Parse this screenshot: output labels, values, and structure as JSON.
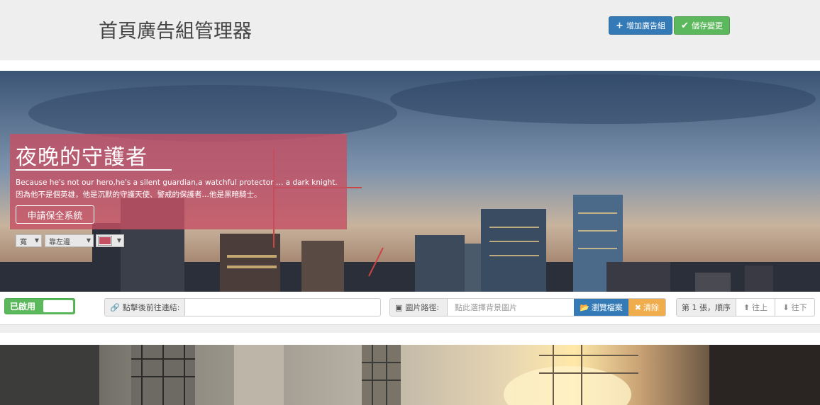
{
  "header": {
    "title": "首頁廣告組管理器",
    "add_button_label": "增加廣告組",
    "save_button_label": "儲存變更"
  },
  "slide": {
    "caption": {
      "title": "夜晚的守護者",
      "subtitle_en": "Because he's not our hero,he's a silent guardian,a watchful protector … a dark knight.",
      "subtitle_zh": "因為他不是個英雄，他是沉默的守護天使、警戒的保護者…他是黑暗騎士。",
      "button_label": "申請保全系統"
    },
    "caption_controls": {
      "width_value": "寬",
      "align_value": "靠左邊",
      "color_value": "#c45064"
    },
    "controls": {
      "enabled_label": "已啟用",
      "link_label": "點擊後前往連結:",
      "link_value": "",
      "image_label": "圖片路徑:",
      "image_placeholder": "點此選擇背景圖片",
      "browse_label": "瀏覽檔案",
      "clear_label": "清除",
      "order_label": "第 1 張，順序",
      "up_label": "往上",
      "down_label": "往下"
    }
  },
  "colors": {
    "primary": "#337ab7",
    "success": "#5cb85c",
    "warning": "#f0ad4e",
    "caption_bg": "#c45064"
  }
}
